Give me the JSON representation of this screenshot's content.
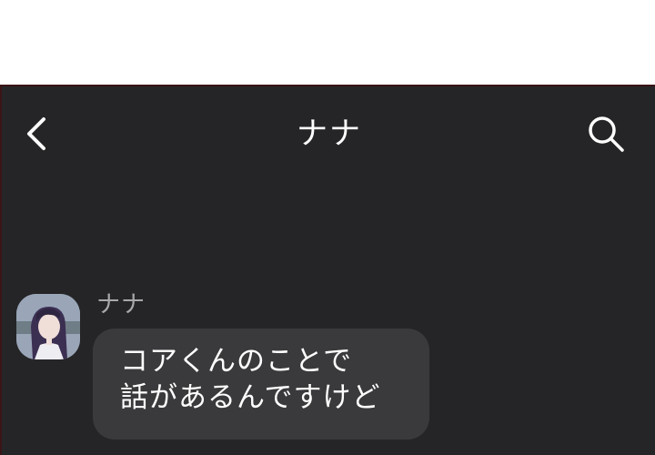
{
  "header": {
    "title": "ナナ",
    "back_icon": "chevron-left-icon",
    "search_icon": "search-icon"
  },
  "message": {
    "sender": "ナナ",
    "lines": [
      "コアくんのことで",
      "話があるんですけど"
    ]
  },
  "colors": {
    "background": "#252527",
    "bubble": "#3a3a3c",
    "text": "#ffffff",
    "sender_text": "#a9a9ac"
  }
}
